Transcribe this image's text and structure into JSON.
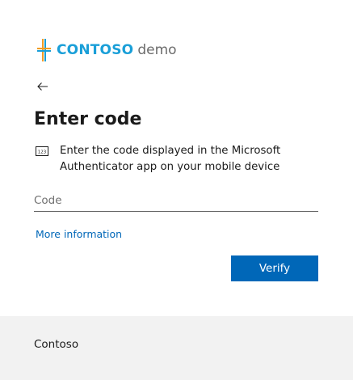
{
  "brand": {
    "name": "CONTOSO",
    "suffix": "demo",
    "name_color": "#1a9fd8",
    "suffix_color": "#6b6b6b",
    "logo_icon": "contoso-cross-logo-icon",
    "logo_colors": [
      "#f29b24",
      "#1a9fd8"
    ]
  },
  "navigation": {
    "back_icon": "arrow-left-icon"
  },
  "page": {
    "title": "Enter code",
    "info_icon": "numeric-code-icon",
    "info_text": "Enter the code displayed in the Microsoft Authenticator app on your mobile device"
  },
  "form": {
    "code_placeholder": "Code",
    "code_value": "",
    "more_info_label": "More information",
    "verify_label": "Verify"
  },
  "footer": {
    "text": "Contoso"
  },
  "colors": {
    "accent": "#0067b8",
    "footer_bg": "#f2f2f2",
    "text": "#1b1b1b"
  }
}
